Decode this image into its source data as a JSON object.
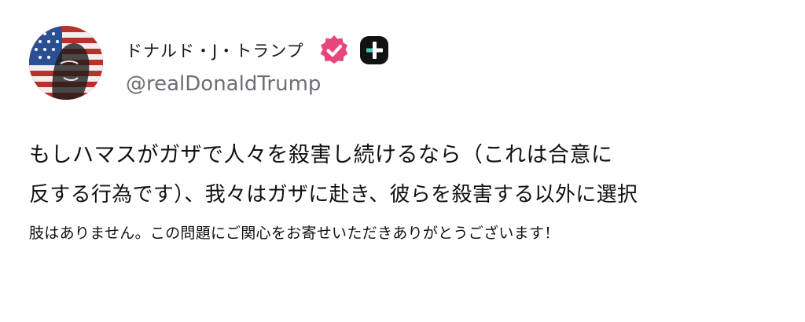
{
  "post": {
    "author": {
      "display_name": "ドナルド・J・トランプ",
      "handle": "@realDonaldTrump"
    },
    "badges": {
      "verified_icon": "verified-badge-icon",
      "plus_icon": "plus-app-icon",
      "verified_color": "#e8457a",
      "plus_color": "#121212",
      "plus_accent": "#3fd0b8"
    },
    "body_lines": [
      "もしハマスがガザで人々を殺害し続けるなら（これは合意に",
      "反する行為です）、我々はガザに赴き、彼らを殺害する以外に選択",
      "肢はありません。この問題にご関心をお寄せいただきありがとうございます！"
    ]
  }
}
